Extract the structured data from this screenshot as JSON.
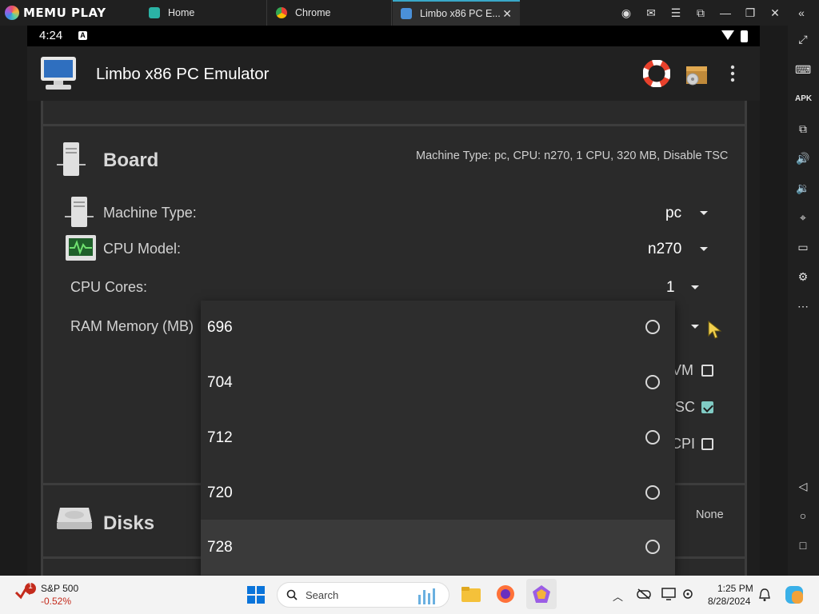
{
  "titlebar": {
    "logo_text": "MEMU PLAY",
    "tabs": [
      {
        "label": "Home",
        "icon": "home-app-icon",
        "color": "#2bb3a5"
      },
      {
        "label": "Chrome",
        "icon": "chrome-icon",
        "color": "#e94235"
      },
      {
        "label": "Limbo x86 PC E...",
        "icon": "limbo-icon",
        "color": "#4a90d9",
        "active": true
      }
    ],
    "close_glyph": "✕"
  },
  "status_bar": {
    "time": "4:24",
    "notification_glyph": "A"
  },
  "app_bar": {
    "title": "Limbo x86 PC Emulator"
  },
  "board": {
    "title": "Board",
    "summary": "Machine Type: pc, CPU: n270, 1 CPU, 320 MB, Disable TSC",
    "machine_type_label": "Machine Type:",
    "machine_type_value": "pc",
    "cpu_model_label": "CPU Model:",
    "cpu_model_value": "n270",
    "cpu_cores_label": "CPU Cores:",
    "cpu_cores_value": "1",
    "ram_label": "RAM Memory (MB)",
    "partial_options": [
      {
        "text": "VM",
        "checked": false
      },
      {
        "text": "SC",
        "checked": true
      },
      {
        "text": "CPI",
        "checked": false
      }
    ]
  },
  "disks": {
    "title": "Disks",
    "summary": "None"
  },
  "ram_popup": {
    "options": [
      {
        "label": "696",
        "selected": false
      },
      {
        "label": "704",
        "selected": false
      },
      {
        "label": "712",
        "selected": false
      },
      {
        "label": "720",
        "selected": false
      },
      {
        "label": "728",
        "selected": false,
        "highlighted": true
      }
    ]
  },
  "taskbar": {
    "stock_name": "S&P 500",
    "stock_change": "-0.52%",
    "stock_badge": "1",
    "search_placeholder": "Search",
    "time": "1:25 PM",
    "date": "8/28/2024"
  },
  "colors": {
    "accent": "#80cbc4",
    "tab_accent": "#39a8c8",
    "negative": "#c42b1c"
  }
}
